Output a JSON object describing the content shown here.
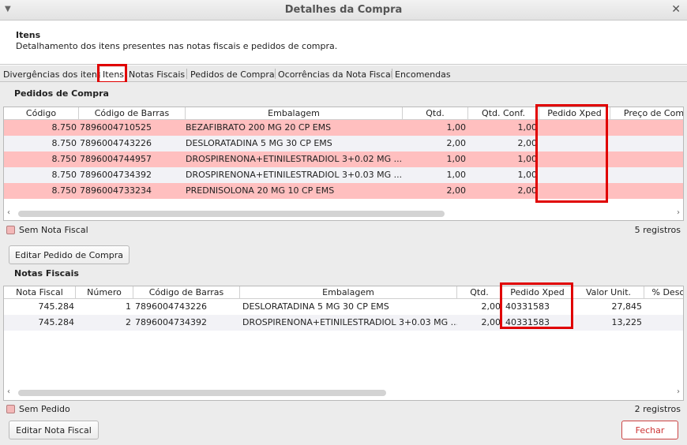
{
  "window": {
    "title": "Detalhes da Compra"
  },
  "header": {
    "title": "Itens",
    "subtitle": "Detalhamento dos itens presentes nas notas fiscais e pedidos de compra."
  },
  "tabs": [
    {
      "label": "Divergências dos itens"
    },
    {
      "label": "Itens"
    },
    {
      "label": "Notas Fiscais"
    },
    {
      "label": "Pedidos de Compra"
    },
    {
      "label": "Ocorrências da Nota Fiscal"
    },
    {
      "label": "Encomendas"
    }
  ],
  "pedidos": {
    "section_label": "Pedidos de Compra",
    "columns": [
      "Código",
      "Código de Barras",
      "Embalagem",
      "Qtd.",
      "Qtd. Conf.",
      "Pedido Xped",
      "Preço de Com"
    ],
    "rows": [
      [
        "8.750",
        "7896004710525",
        "BEZAFIBRATO 200 MG 20 CP EMS",
        "1,00",
        "1,00",
        "",
        ""
      ],
      [
        "8.750",
        "7896004743226",
        "DESLORATADINA 5 MG 30 CP EMS",
        "2,00",
        "2,00",
        "",
        ""
      ],
      [
        "8.750",
        "7896004744957",
        "DROSPIRENONA+ETINILESTRADIOL 3+0.02 MG ...",
        "1,00",
        "1,00",
        "",
        ""
      ],
      [
        "8.750",
        "7896004734392",
        "DROSPIRENONA+ETINILESTRADIOL 3+0.03 MG ...",
        "1,00",
        "1,00",
        "",
        ""
      ],
      [
        "8.750",
        "7896004733234",
        "PREDNISOLONA 20 MG 10 CP EMS",
        "2,00",
        "2,00",
        "",
        ""
      ]
    ],
    "legend": "Sem Nota Fiscal",
    "count": "5 registros",
    "edit_button": "Editar Pedido de Compra"
  },
  "notas": {
    "section_label": "Notas Fiscais",
    "columns": [
      "Nota Fiscal",
      "Número",
      "Código de Barras",
      "Embalagem",
      "Qtd.",
      "Pedido Xped",
      "Valor Unit.",
      "% Desc"
    ],
    "rows": [
      [
        "745.284",
        "1",
        "7896004743226",
        "DESLORATADINA 5 MG 30 CP EMS",
        "2,00",
        "40331583",
        "27,845",
        ""
      ],
      [
        "745.284",
        "2",
        "7896004734392",
        "DROSPIRENONA+ETINILESTRADIOL 3+0.03 MG ...",
        "2,00",
        "40331583",
        "13,225",
        ""
      ]
    ],
    "legend": "Sem Pedido",
    "count": "2 registros",
    "edit_button": "Editar Nota Fiscal"
  },
  "footer": {
    "close_button": "Fechar"
  },
  "colors": {
    "row_highlight": "#ffbfbf",
    "annotation_red": "#e00000",
    "close_accent": "#cc3333"
  }
}
